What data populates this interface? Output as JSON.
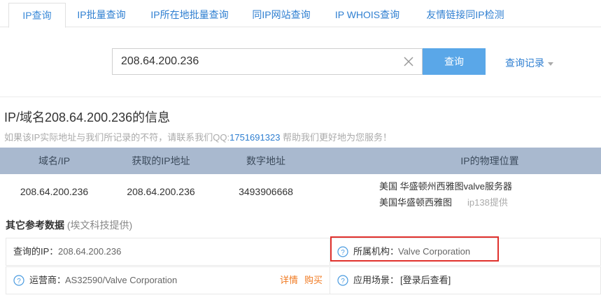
{
  "tabs": [
    {
      "label": "IP查询"
    },
    {
      "label": "IP批量查询"
    },
    {
      "label": "IP所在地批量查询"
    },
    {
      "label": "同IP网站查询"
    },
    {
      "label": "IP WHOIS查询"
    },
    {
      "label": "友情链接同IP检测"
    }
  ],
  "search": {
    "value": "208.64.200.236",
    "button_label": "查询",
    "history_label": "查询记录"
  },
  "info": {
    "title": "IP/域名208.64.200.236的信息",
    "notice_prefix": "如果该IP实际地址与我们所记录的不符，请联系我们QQ:",
    "notice_qq": "1751691323",
    "notice_suffix": " 帮助我们更好地为您服务！"
  },
  "table": {
    "headers": [
      "域名/IP",
      "获取的IP地址",
      "数字地址",
      "IP的物理位置"
    ],
    "row": {
      "domain_ip": "208.64.200.236",
      "ip": "208.64.200.236",
      "numeric": "3493906668",
      "location1": "美国 华盛顿州西雅图valve服务器",
      "location2": "美国华盛顿西雅图",
      "location2_source": "ip138提供"
    }
  },
  "reference": {
    "title": "其它参考数据",
    "subtitle": "(埃文科技提供)",
    "queried_ip_label": "查询的IP：",
    "queried_ip_value": "208.64.200.236",
    "org_label": "所属机构：",
    "org_value": "Valve Corporation",
    "isp_label": "运营商：",
    "isp_value": "AS32590/Valve Corporation",
    "details_link": "详情",
    "buy_link": "购买",
    "scene_label": "应用场景：",
    "scene_value": "[登录后查看]"
  },
  "colors": {
    "accent": "#5aa7e8",
    "highlight": "#e0312d",
    "table_header": "#a9b9cf"
  }
}
